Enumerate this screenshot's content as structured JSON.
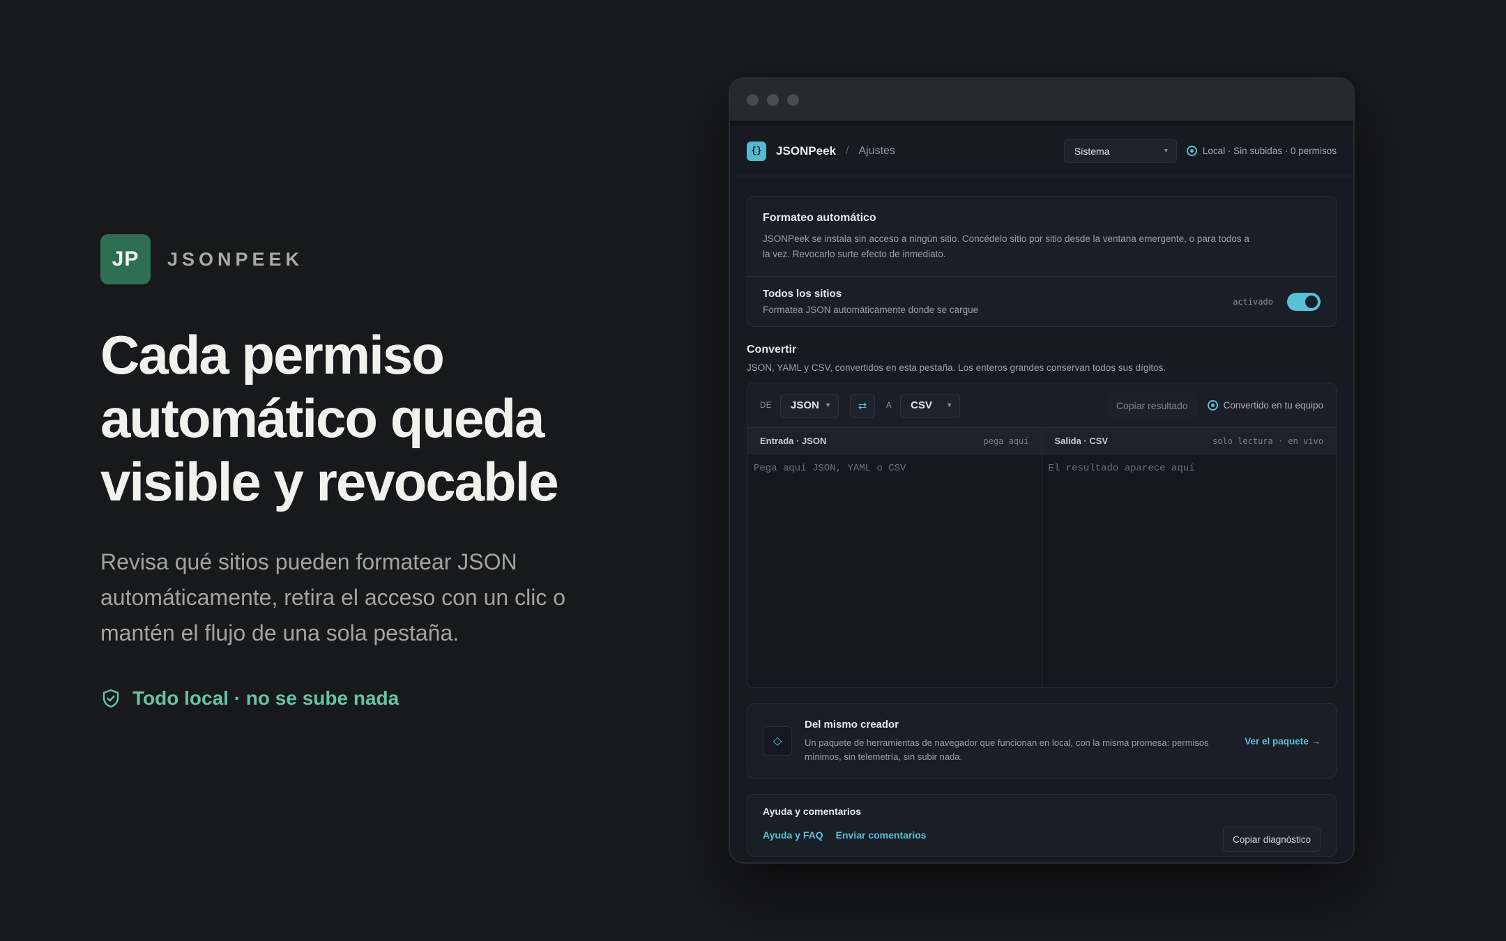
{
  "brand": {
    "logo_text": "JP",
    "name": "JSONPEEK"
  },
  "headline": {
    "lines": [
      "Cada permiso",
      "automático queda",
      "visible y revocable"
    ]
  },
  "subhead": "Revisa qué sitios pueden formatear JSON automáticamente, retira el acceso con un clic o mantén el flujo de una sola pestaña.",
  "local_note": "Todo local · no se sube nada",
  "colors": {
    "accent": "#5bbfd6",
    "green": "#66c4a4",
    "logo_bg": "#2d6e55",
    "background": "#18191b"
  },
  "app": {
    "icon_text": "{}",
    "name": "JSONPeek",
    "breadcrumb_sep": "/",
    "breadcrumb": "Ajustes",
    "theme_select": "Sistema",
    "status": "Local · Sin subidas · 0 permisos"
  },
  "auto_format": {
    "title": "Formateo automático",
    "description": "JSONPeek se instala sin acceso a ningún sitio. Concédelo sitio por sitio desde la ventana emergente, o para todos a la vez. Revocarlo surte efecto de inmediato.",
    "all_sites_title": "Todos los sitios",
    "all_sites_sub": "Formatea JSON automáticamente donde se cargue",
    "toggle_label": "activado",
    "toggle_on": true
  },
  "convert": {
    "title": "Convertir",
    "description": "JSON, YAML y CSV, convertidos en esta pestaña. Los enteros grandes conservan todos sus dígitos.",
    "from_label": "DE",
    "from_value": "JSON",
    "to_label": "A",
    "to_value": "CSV",
    "copy_button": "Copiar resultado",
    "status": "Convertido en tu equipo",
    "input_title": "Entrada · JSON",
    "input_hint": "pega aquí",
    "input_placeholder": "Pega aquí JSON, YAML o CSV",
    "output_title": "Salida · CSV",
    "output_hint": "solo lectura · en vivo",
    "output_placeholder": "El resultado aparece aquí"
  },
  "creator": {
    "title": "Del mismo creador",
    "description": "Un paquete de herramientas de navegador que funcionan en local, con la misma promesa: permisos mínimos, sin telemetría, sin subir nada.",
    "link": "Ver el paquete →"
  },
  "help": {
    "title": "Ayuda y comentarios",
    "faq_link": "Ayuda y FAQ",
    "feedback_link": "Enviar comentarios",
    "diag_button": "Copiar diagnóstico"
  }
}
